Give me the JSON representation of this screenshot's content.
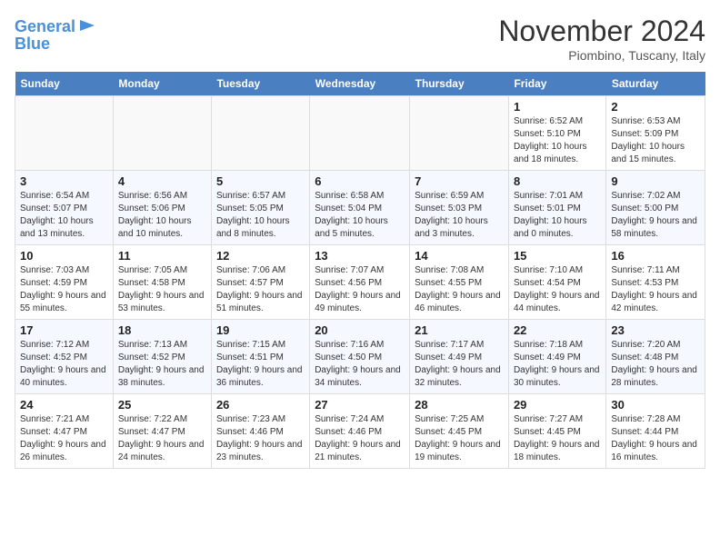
{
  "logo": {
    "line1": "General",
    "line2": "Blue"
  },
  "title": "November 2024",
  "location": "Piombino, Tuscany, Italy",
  "days_of_week": [
    "Sunday",
    "Monday",
    "Tuesday",
    "Wednesday",
    "Thursday",
    "Friday",
    "Saturday"
  ],
  "weeks": [
    [
      {
        "day": "",
        "info": ""
      },
      {
        "day": "",
        "info": ""
      },
      {
        "day": "",
        "info": ""
      },
      {
        "day": "",
        "info": ""
      },
      {
        "day": "",
        "info": ""
      },
      {
        "day": "1",
        "info": "Sunrise: 6:52 AM\nSunset: 5:10 PM\nDaylight: 10 hours and 18 minutes."
      },
      {
        "day": "2",
        "info": "Sunrise: 6:53 AM\nSunset: 5:09 PM\nDaylight: 10 hours and 15 minutes."
      }
    ],
    [
      {
        "day": "3",
        "info": "Sunrise: 6:54 AM\nSunset: 5:07 PM\nDaylight: 10 hours and 13 minutes."
      },
      {
        "day": "4",
        "info": "Sunrise: 6:56 AM\nSunset: 5:06 PM\nDaylight: 10 hours and 10 minutes."
      },
      {
        "day": "5",
        "info": "Sunrise: 6:57 AM\nSunset: 5:05 PM\nDaylight: 10 hours and 8 minutes."
      },
      {
        "day": "6",
        "info": "Sunrise: 6:58 AM\nSunset: 5:04 PM\nDaylight: 10 hours and 5 minutes."
      },
      {
        "day": "7",
        "info": "Sunrise: 6:59 AM\nSunset: 5:03 PM\nDaylight: 10 hours and 3 minutes."
      },
      {
        "day": "8",
        "info": "Sunrise: 7:01 AM\nSunset: 5:01 PM\nDaylight: 10 hours and 0 minutes."
      },
      {
        "day": "9",
        "info": "Sunrise: 7:02 AM\nSunset: 5:00 PM\nDaylight: 9 hours and 58 minutes."
      }
    ],
    [
      {
        "day": "10",
        "info": "Sunrise: 7:03 AM\nSunset: 4:59 PM\nDaylight: 9 hours and 55 minutes."
      },
      {
        "day": "11",
        "info": "Sunrise: 7:05 AM\nSunset: 4:58 PM\nDaylight: 9 hours and 53 minutes."
      },
      {
        "day": "12",
        "info": "Sunrise: 7:06 AM\nSunset: 4:57 PM\nDaylight: 9 hours and 51 minutes."
      },
      {
        "day": "13",
        "info": "Sunrise: 7:07 AM\nSunset: 4:56 PM\nDaylight: 9 hours and 49 minutes."
      },
      {
        "day": "14",
        "info": "Sunrise: 7:08 AM\nSunset: 4:55 PM\nDaylight: 9 hours and 46 minutes."
      },
      {
        "day": "15",
        "info": "Sunrise: 7:10 AM\nSunset: 4:54 PM\nDaylight: 9 hours and 44 minutes."
      },
      {
        "day": "16",
        "info": "Sunrise: 7:11 AM\nSunset: 4:53 PM\nDaylight: 9 hours and 42 minutes."
      }
    ],
    [
      {
        "day": "17",
        "info": "Sunrise: 7:12 AM\nSunset: 4:52 PM\nDaylight: 9 hours and 40 minutes."
      },
      {
        "day": "18",
        "info": "Sunrise: 7:13 AM\nSunset: 4:52 PM\nDaylight: 9 hours and 38 minutes."
      },
      {
        "day": "19",
        "info": "Sunrise: 7:15 AM\nSunset: 4:51 PM\nDaylight: 9 hours and 36 minutes."
      },
      {
        "day": "20",
        "info": "Sunrise: 7:16 AM\nSunset: 4:50 PM\nDaylight: 9 hours and 34 minutes."
      },
      {
        "day": "21",
        "info": "Sunrise: 7:17 AM\nSunset: 4:49 PM\nDaylight: 9 hours and 32 minutes."
      },
      {
        "day": "22",
        "info": "Sunrise: 7:18 AM\nSunset: 4:49 PM\nDaylight: 9 hours and 30 minutes."
      },
      {
        "day": "23",
        "info": "Sunrise: 7:20 AM\nSunset: 4:48 PM\nDaylight: 9 hours and 28 minutes."
      }
    ],
    [
      {
        "day": "24",
        "info": "Sunrise: 7:21 AM\nSunset: 4:47 PM\nDaylight: 9 hours and 26 minutes."
      },
      {
        "day": "25",
        "info": "Sunrise: 7:22 AM\nSunset: 4:47 PM\nDaylight: 9 hours and 24 minutes."
      },
      {
        "day": "26",
        "info": "Sunrise: 7:23 AM\nSunset: 4:46 PM\nDaylight: 9 hours and 23 minutes."
      },
      {
        "day": "27",
        "info": "Sunrise: 7:24 AM\nSunset: 4:46 PM\nDaylight: 9 hours and 21 minutes."
      },
      {
        "day": "28",
        "info": "Sunrise: 7:25 AM\nSunset: 4:45 PM\nDaylight: 9 hours and 19 minutes."
      },
      {
        "day": "29",
        "info": "Sunrise: 7:27 AM\nSunset: 4:45 PM\nDaylight: 9 hours and 18 minutes."
      },
      {
        "day": "30",
        "info": "Sunrise: 7:28 AM\nSunset: 4:44 PM\nDaylight: 9 hours and 16 minutes."
      }
    ]
  ]
}
